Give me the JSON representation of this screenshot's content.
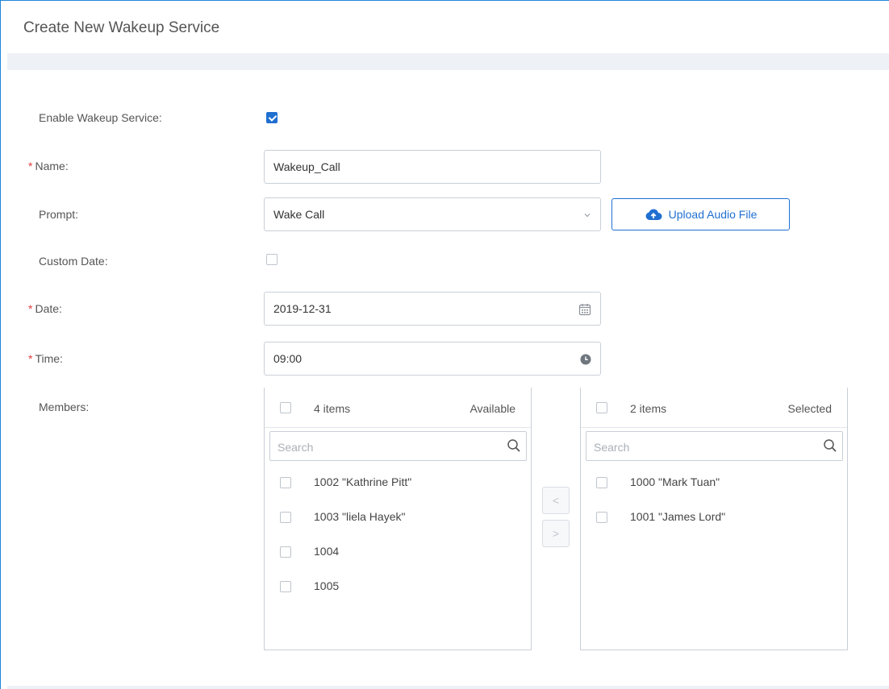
{
  "dialog": {
    "title": "Create New Wakeup Service"
  },
  "form": {
    "enable_label": "Enable Wakeup Service",
    "enable_checked": true,
    "name_label": "Name",
    "name_value": "Wakeup_Call",
    "prompt_label": "Prompt",
    "prompt_value": "Wake Call",
    "upload_label": "Upload Audio File",
    "custom_date_label": "Custom Date",
    "custom_date_checked": false,
    "date_label": "Date",
    "date_value": "2019-12-31",
    "time_label": "Time",
    "time_value": "09:00",
    "members_label": "Members",
    "required_marker": "*",
    "label_suffix": ":"
  },
  "available": {
    "count": "4 items",
    "title": "Available",
    "search_placeholder": "Search",
    "items": [
      "1002 \"Kathrine Pitt\"",
      "1003 \"liela Hayek\"",
      "1004",
      "1005"
    ]
  },
  "selected": {
    "count": "2 items",
    "title": "Selected",
    "search_placeholder": "Search",
    "items": [
      "1000 \"Mark Tuan\"",
      "1001 \"James Lord\""
    ]
  },
  "transfer": {
    "left_arrow": "<",
    "right_arrow": ">"
  },
  "colors": {
    "accent": "#1f6fd1",
    "required": "#e63c3c",
    "frame": "#1f86d8"
  }
}
